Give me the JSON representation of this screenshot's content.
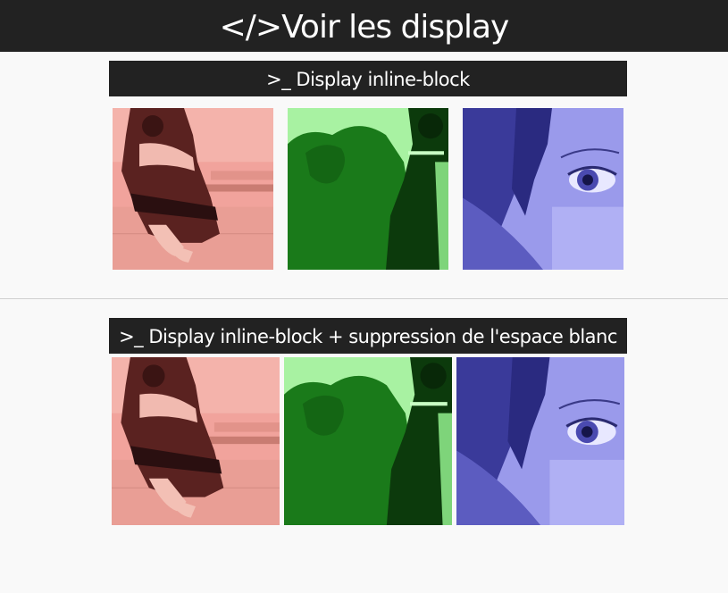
{
  "header": {
    "title": "</>Voir les display"
  },
  "sections": [
    {
      "title": ">_ Display inline-block",
      "images": [
        {
          "name": "seated-woman-photo",
          "tint": "#f3a6a0"
        },
        {
          "name": "shadow-silhouette-photo",
          "tint": "#a6f0a0"
        },
        {
          "name": "eye-closeup-photo",
          "tint": "#9c9cf0"
        }
      ]
    },
    {
      "title": ">_ Display inline-block + suppression de l'espace blanc",
      "images": [
        {
          "name": "seated-woman-photo",
          "tint": "#f3a6a0"
        },
        {
          "name": "shadow-silhouette-photo",
          "tint": "#a6f0a0"
        },
        {
          "name": "eye-closeup-photo",
          "tint": "#9c9cf0"
        }
      ]
    }
  ],
  "colors": {
    "bar": "#222222",
    "background": "#f9f9f9",
    "divider": "#cfcfcf"
  }
}
